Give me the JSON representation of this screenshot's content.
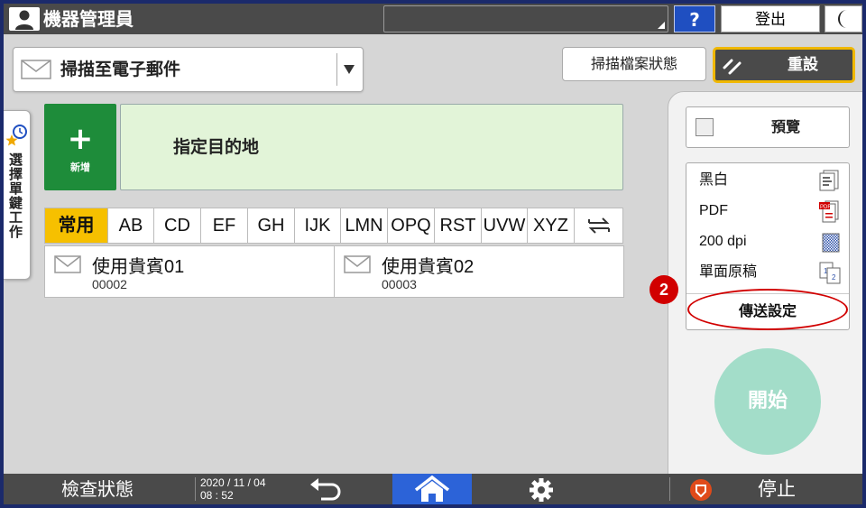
{
  "topbar": {
    "title": "機器管理員",
    "help_label": "?",
    "logout_label": "登出"
  },
  "scan_mode": {
    "label": "掃描至電子郵件"
  },
  "toolbar": {
    "scan_status_label": "掃描檔案狀態",
    "reset_label": "重設"
  },
  "side_tab": {
    "label": "選擇單鍵工作"
  },
  "destination": {
    "add_label": "新增",
    "field_label": "指定目的地"
  },
  "index_tabs": [
    "常用",
    "AB",
    "CD",
    "EF",
    "GH",
    "IJK",
    "LMN",
    "OPQ",
    "RST",
    "UVW",
    "XYZ"
  ],
  "address_list": [
    {
      "name": "使用貴賓01",
      "number": "00002"
    },
    {
      "name": "使用貴賓02",
      "number": "00003"
    }
  ],
  "right_panel": {
    "preview_label": "預覽",
    "settings": [
      "黑白",
      "PDF",
      "200 dpi",
      "單面原稿"
    ],
    "send_settings_label": "傳送設定",
    "step_number": "2",
    "start_label": "開始"
  },
  "bottombar": {
    "check_status_label": "檢查狀態",
    "date": "2020 / 11 / 04",
    "time": "08 : 52",
    "stop_label": "停止"
  },
  "colors": {
    "topbar_bg": "#4a4a4a",
    "add_button": "#1e8c3a",
    "destination_bg": "#e2f4d8",
    "active_tab": "#f6c000",
    "reset_border": "#f0b800",
    "highlight_red": "#d10000",
    "start_button": "#a3ddc9",
    "home_button": "#2c63d8",
    "help_button": "#1f4fc1"
  }
}
